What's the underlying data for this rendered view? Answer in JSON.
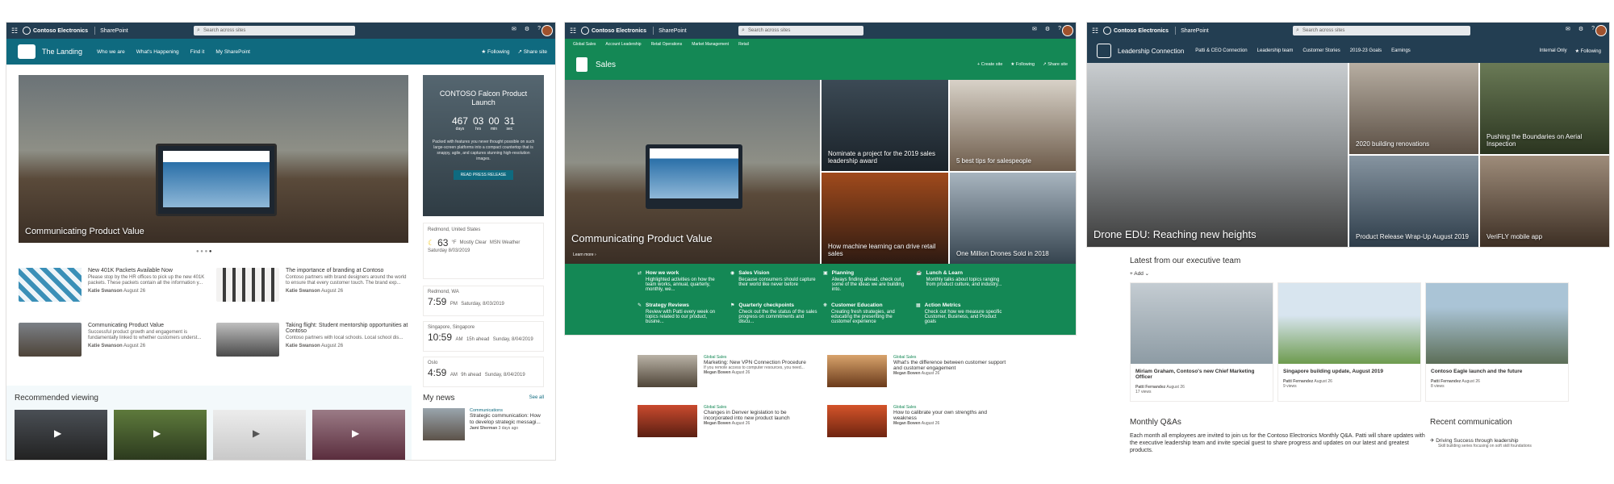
{
  "colors": {
    "suite": "#233e52",
    "landing_hub": "#0f6a7f",
    "sales_green": "#148855",
    "leader_hub": "#233e52"
  },
  "suite": {
    "brand": "Contoso Electronics",
    "app": "SharePoint",
    "search_placeholder": "Search across sites"
  },
  "landing": {
    "site_title": "The Landing",
    "nav": [
      "Who we are",
      "What's Happening",
      "Find it",
      "My SharePoint"
    ],
    "following": "Following",
    "share": "Share site",
    "hero_caption": "Communicating Product Value",
    "event": {
      "title": "CONTOSO Falcon Product Launch",
      "countdown": [
        {
          "v": "467",
          "u": "days"
        },
        {
          "v": "03",
          "u": "hrs"
        },
        {
          "v": "00",
          "u": "min"
        },
        {
          "v": "31",
          "u": "sec"
        }
      ],
      "body": "Packed with features you never thought possible on such large-screen platforms into a compact countertop that is snappy, agile, and captures stunning high-resolution images.",
      "button": "READ PRESS RELEASE"
    },
    "weather": {
      "place": "Redmond, United States",
      "temp": "63",
      "unit": "°F",
      "cond": "Mostly Clear",
      "date": "Saturday 8/03/2019",
      "src": "MSN Weather"
    },
    "clocks": [
      {
        "place": "Redmond, WA",
        "time": "7:59",
        "ampm": "PM",
        "date": "Saturday, 8/03/2019",
        "ahead": ""
      },
      {
        "place": "Singapore, Singapore",
        "time": "10:59",
        "ampm": "AM",
        "date": "Sunday, 8/04/2019",
        "ahead": "15h ahead"
      },
      {
        "place": "Oslo",
        "time": "4:59",
        "ampm": "AM",
        "date": "Sunday, 8/04/2019",
        "ahead": "9h ahead"
      }
    ],
    "news": [
      {
        "title": "New 401K Packets Available Now",
        "body": "Please stop by the HR offices to pick up the new 401K packets. These packets contain all the information y...",
        "author": "Katie Swanson",
        "date": "August 26"
      },
      {
        "title": "The importance of branding at Contoso",
        "body": "Contoso partners with brand designers around the world to ensure that every customer touch. The brand exp...",
        "author": "Katie Swanson",
        "date": "August 26"
      },
      {
        "title": "Communicating Product Value",
        "body": "Successful product growth and engagement is fundamentally linked to whether customers underst...",
        "author": "Katie Swanson",
        "date": "August 26"
      },
      {
        "title": "Taking flight: Student mentorship opportunities at Contoso",
        "body": "Contoso partners with local schools. Local school dis...",
        "author": "Katie Swanson",
        "date": "August 26"
      }
    ],
    "recommended": "Recommended viewing",
    "mynews": {
      "title": "My news",
      "seeall": "See all",
      "cat": "Communications",
      "headline": "Strategic communication: How to develop strategic messagi...",
      "author": "Jami Sherman",
      "ago": "3 days ago"
    }
  },
  "sales": {
    "subnav": [
      "Global Sales",
      "Account Leadership",
      "Retail Operations",
      "Market Management",
      "Retail"
    ],
    "title": "Sales",
    "create": "Create site",
    "following": "Following",
    "share": "Share site",
    "hero_caption": "Communicating Product Value",
    "learn": "Learn more",
    "tiles": [
      "Nominate a project for the 2019 sales leadership award",
      "5 best tips for salespeople",
      "How machine learning can drive retail sales",
      "One Million Drones Sold in 2018"
    ],
    "grid": [
      {
        "t": "How we work",
        "d": "Highlighted activities on how the team works, annual, quarterly, monthly, we..."
      },
      {
        "t": "Sales Vision",
        "d": "Because consumers should capture their world like never before"
      },
      {
        "t": "Planning",
        "d": "Always finding ahead, check out some of the ideas we are building into."
      },
      {
        "t": "Lunch & Learn",
        "d": "Monthly talks about topics ranging from product culture, and industry..."
      },
      {
        "t": "Strategy Reviews",
        "d": "Review with Patti every week on topics related to our product, busine..."
      },
      {
        "t": "Quarterly checkpoints",
        "d": "Check out the the status of the sales progress on commitments and discu..."
      },
      {
        "t": "Customer Education",
        "d": "Creating fresh strategies, and educating the presenting the customer experience"
      },
      {
        "t": "Action Metrics",
        "d": "Check out how we measure specific Customer, Business, and Product goals"
      }
    ],
    "news": [
      {
        "cat": "Global Sales",
        "title": "Marketing: New VPN Connection Procedure",
        "body": "If you remote access to computer resources, you need...",
        "author": "Megan Bowen",
        "date": "August 26"
      },
      {
        "cat": "Global Sales",
        "title": "What's the difference between customer support and customer engagement",
        "body": "",
        "author": "Megan Bowen",
        "date": "August 26"
      },
      {
        "cat": "Global Sales",
        "title": "Changes in Denver legislation to be incorporated into new product launch",
        "body": "",
        "author": "Megan Bowen",
        "date": "August 26"
      },
      {
        "cat": "Global Sales",
        "title": "How to calibrate your own strengths and weakness",
        "body": "",
        "author": "Megan Bowen",
        "date": "August 26"
      }
    ]
  },
  "leadership": {
    "title": "Leadership Connection",
    "nav": [
      "Patti & CEO Connection",
      "Leadership team",
      "Customer Stories",
      "2019-23 Goals",
      "Earnings"
    ],
    "internal": "Internal Only",
    "following": "Following",
    "hero_caption": "Drone EDU: Reaching new heights",
    "tiles": [
      "2020 building renovations",
      "Pushing the Boundaries on Aerial Inspection",
      "Product Release Wrap-Up August 2019",
      "VeriFLY mobile app"
    ],
    "latest": "Latest from our executive team",
    "add": "Add",
    "cards": [
      {
        "title": "Miriam Graham, Contoso's new Chief Marketing Officer",
        "author": "Patti Fernandez",
        "date": "August 26",
        "views": "17 views"
      },
      {
        "title": "Singapore building update, August 2019",
        "author": "Patti Fernandez",
        "date": "August 26",
        "views": "9 views"
      },
      {
        "title": "Contoso Eagle launch and the future",
        "author": "Patti Fernandez",
        "date": "August 26",
        "views": "8 views"
      }
    ],
    "qa_title": "Monthly Q&As",
    "qa_body": "Each month all employees are invited to join us for the Contoso Electronics Monthly Q&A. Patti will share updates with the executive leadership team and invite special guest to share progress and updates on our latest and greatest products.",
    "recent": "Recent communication",
    "recent_item": "Driving Success through leadership",
    "recent_sub": "Skill building series focusing on soft skill foundations"
  }
}
